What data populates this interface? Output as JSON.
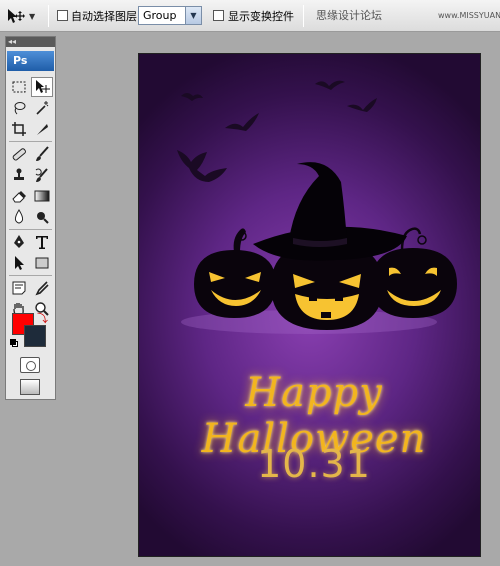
{
  "options_bar": {
    "auto_select_label": "自动选择图层",
    "auto_select_value": "Group",
    "show_transform_label": "显示变换控件",
    "watermark": "思缘设计论坛",
    "watermark_url": "www.MISSYUAN.COM"
  },
  "tools": {
    "logo": "Ps"
  },
  "document": {
    "greeting": "Happy Halloween",
    "date": "10.31"
  },
  "colors": {
    "foreground": "#ff0000",
    "background": "#1e2b3a",
    "text_gold": "#f2b51f"
  }
}
